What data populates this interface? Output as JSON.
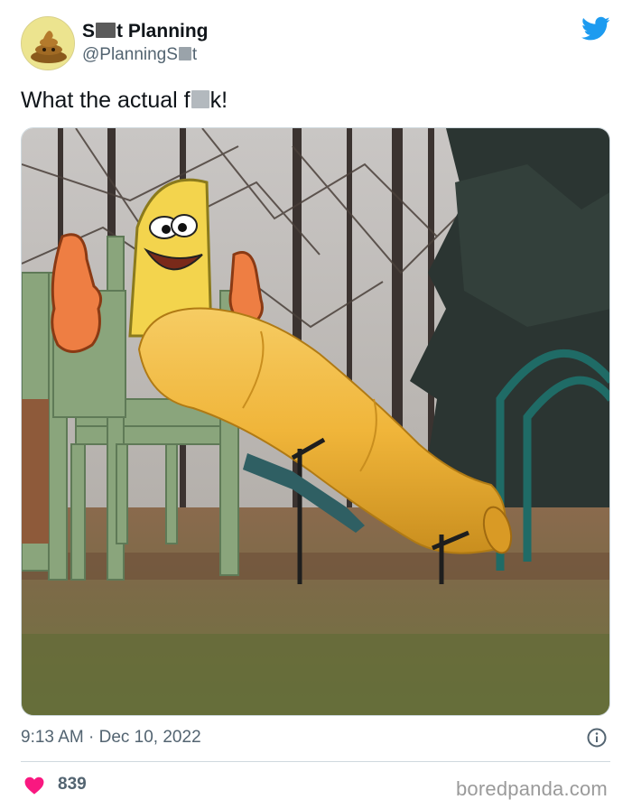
{
  "tweet": {
    "author_name_start": "S",
    "author_name_end": "t Planning",
    "handle_start": "@PlanningS",
    "handle_end": "t",
    "text_start": "What the actual f",
    "text_end": "k!",
    "time": "9:13 AM",
    "separator": "·",
    "date": "Dec 10, 2022",
    "likes": "839"
  },
  "colors": {
    "twitter_blue": "#1d9bf0",
    "like_red": "#f91880",
    "muted": "#536471"
  },
  "icons": {
    "brand": "twitter-bird-icon",
    "info": "info-icon",
    "like": "heart-icon",
    "avatar": "poop-emoji-icon"
  },
  "watermark": "boredpanda.com"
}
